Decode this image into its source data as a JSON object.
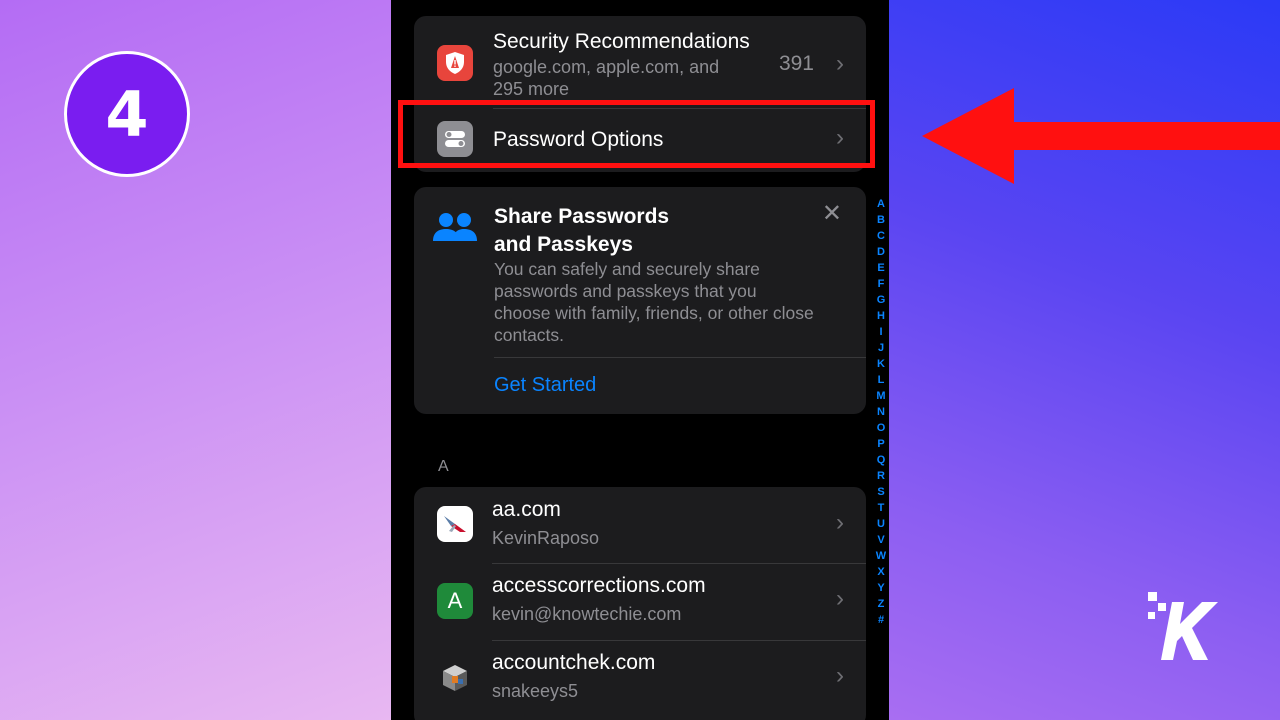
{
  "step": {
    "number": "4"
  },
  "security": {
    "title": "Security Recommendations",
    "subtitle": "google.com, apple.com, and 295 more",
    "count": "391"
  },
  "password_options": {
    "title": "Password Options"
  },
  "share": {
    "title_line1": "Share Passwords",
    "title_line2": "and Passkeys",
    "body": "You can safely and securely share passwords and passkeys that you choose with family, friends, or other close contacts.",
    "link": "Get Started"
  },
  "section": {
    "letter": "A"
  },
  "accounts": [
    {
      "domain": "aa.com",
      "user": "KevinRaposo",
      "icon_letter": ""
    },
    {
      "domain": "accesscorrections.com",
      "user": "kevin@knowtechie.com",
      "icon_letter": "A"
    },
    {
      "domain": "accountchek.com",
      "user": "snakeeys5",
      "icon_letter": ""
    }
  ],
  "index_letters": [
    "A",
    "B",
    "C",
    "D",
    "E",
    "F",
    "G",
    "H",
    "I",
    "J",
    "K",
    "L",
    "M",
    "N",
    "O",
    "P",
    "Q",
    "R",
    "S",
    "T",
    "U",
    "V",
    "W",
    "X",
    "Y",
    "Z",
    "#"
  ],
  "colors": {
    "accent": "#0a84ff",
    "highlight": "#ff1010",
    "badge": "#7a1df0",
    "card": "#1c1c1e"
  },
  "icons": {
    "security": "shield-warning-icon",
    "options": "toggle-icon",
    "share": "people-icon",
    "close": "close-icon",
    "chevron": "chevron-right-icon",
    "arrow": "left-arrow-icon",
    "logo": "knowtechie-logo-icon"
  }
}
